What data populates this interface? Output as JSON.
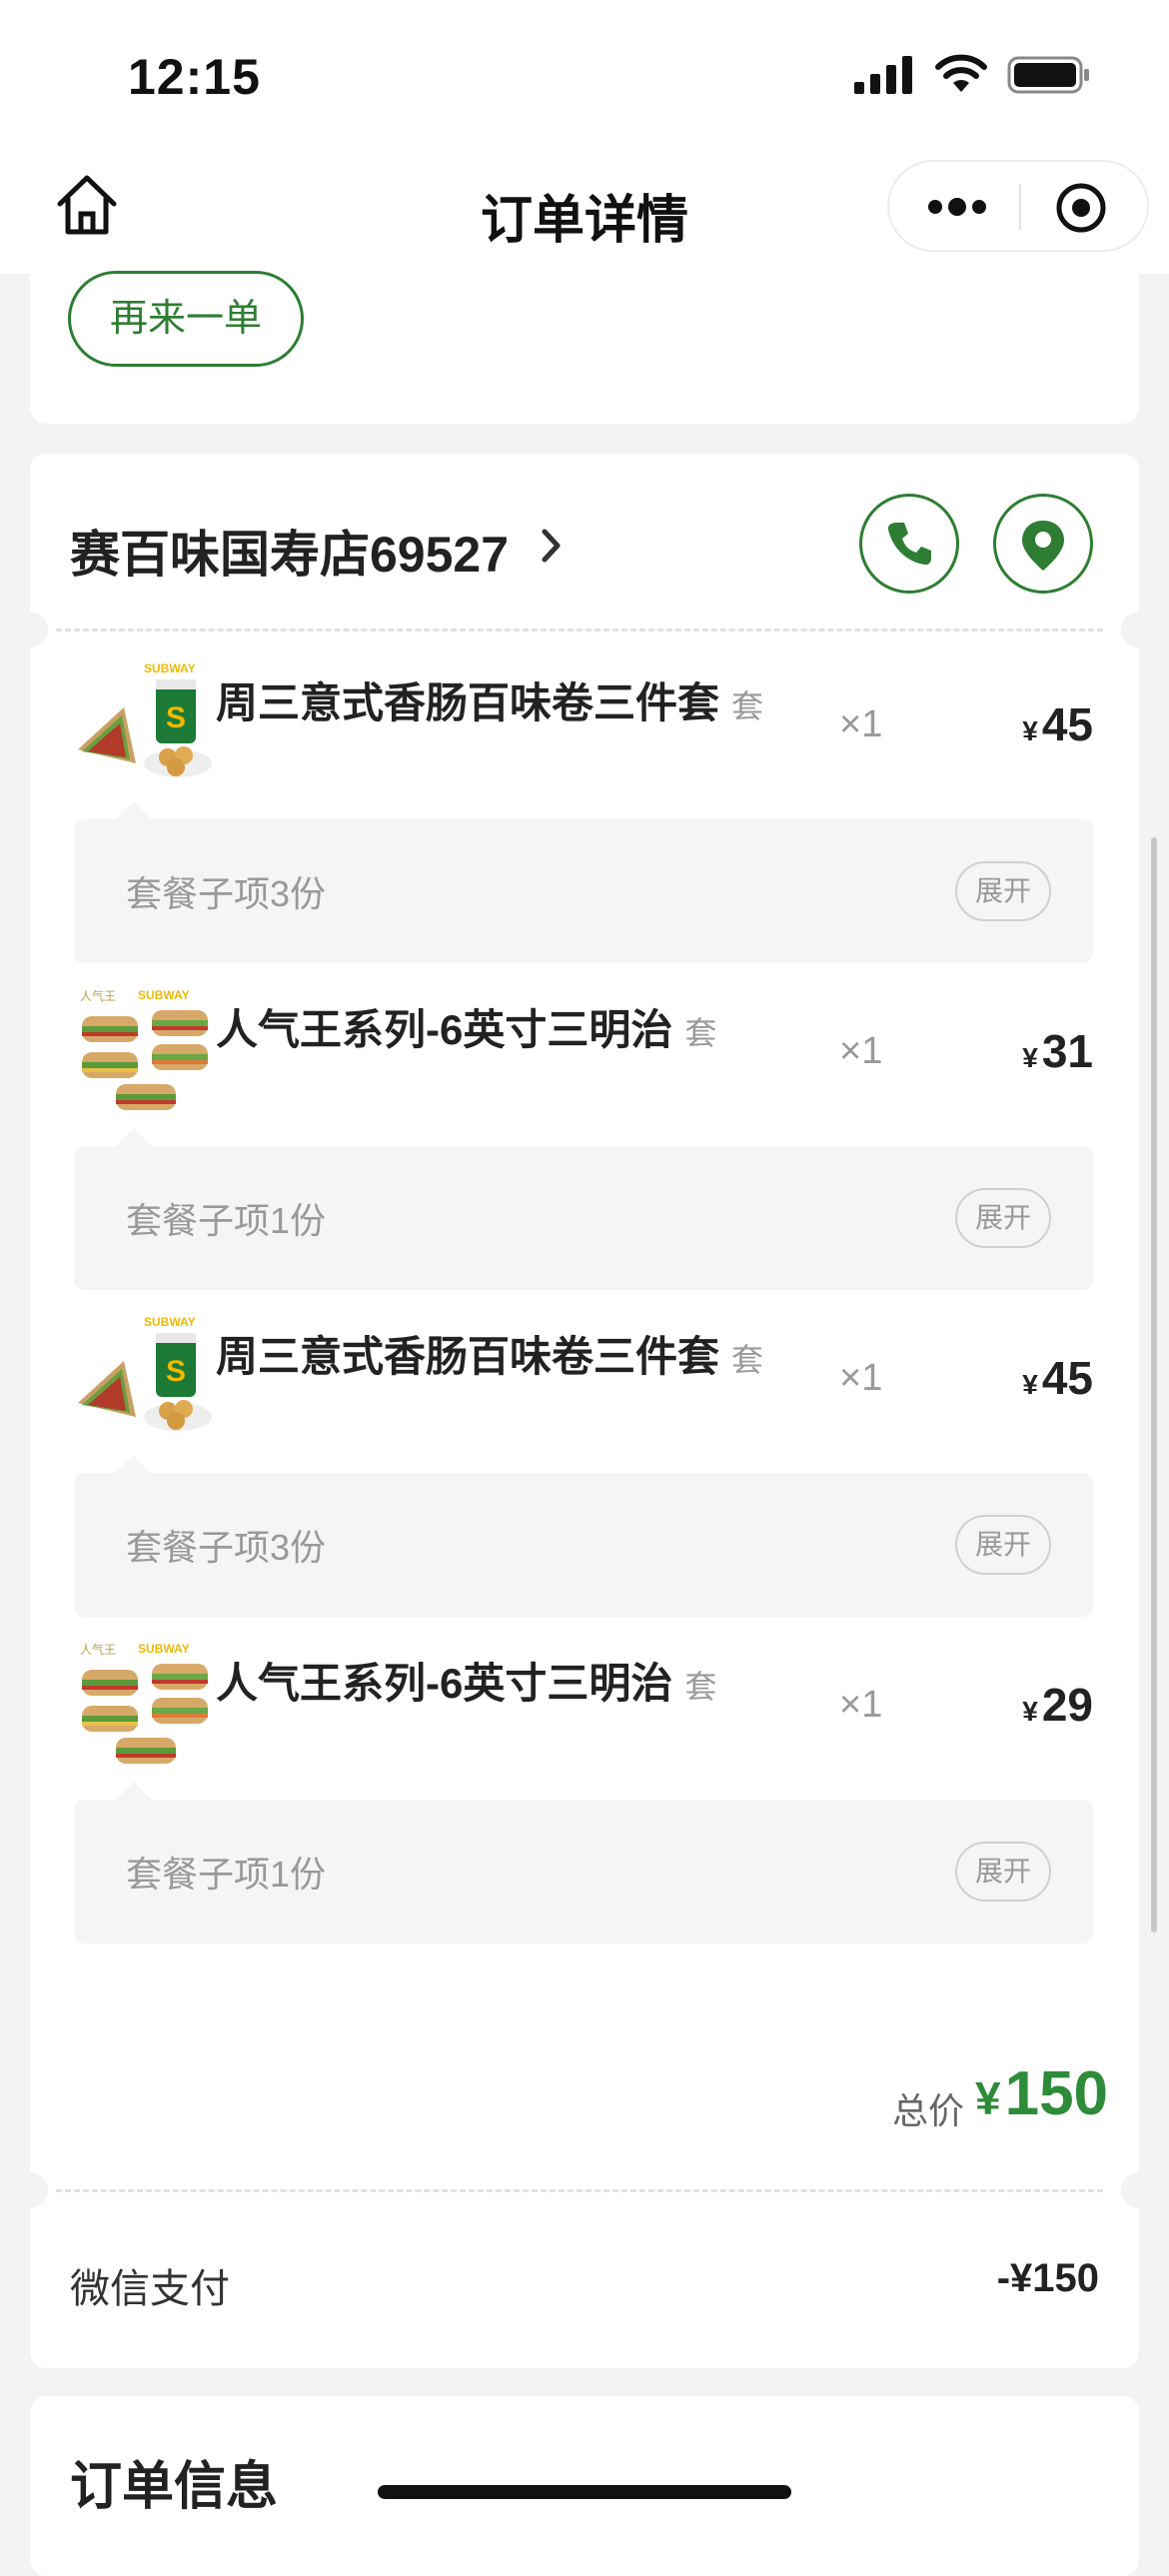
{
  "status": {
    "time": "12:15"
  },
  "nav": {
    "title": "订单详情"
  },
  "actions": {
    "reorder": "再来一单"
  },
  "store": {
    "name": "赛百味国寿店69527"
  },
  "items": [
    {
      "name": "周三意式香肠百味卷三件套",
      "tag": "套",
      "qty": "×1",
      "currency": "¥",
      "price": "45",
      "sub": "套餐子项3份",
      "expand": "展开"
    },
    {
      "name": "人气王系列-6英寸三明治",
      "tag": "套",
      "qty": "×1",
      "currency": "¥",
      "price": "31",
      "sub": "套餐子项1份",
      "expand": "展开"
    },
    {
      "name": "周三意式香肠百味卷三件套",
      "tag": "套",
      "qty": "×1",
      "currency": "¥",
      "price": "45",
      "sub": "套餐子项3份",
      "expand": "展开"
    },
    {
      "name": "人气王系列-6英寸三明治",
      "tag": "套",
      "qty": "×1",
      "currency": "¥",
      "price": "29",
      "sub": "套餐子项1份",
      "expand": "展开"
    }
  ],
  "total": {
    "label": "总价",
    "currency": "¥",
    "value": "150"
  },
  "payment": {
    "method": "微信支付",
    "amount": "-¥150"
  },
  "order_info": {
    "title": "订单信息"
  },
  "colors": {
    "accent": "#2e7d32",
    "price_green": "#2e8b3a"
  },
  "icons": [
    "home-icon",
    "more-icon",
    "close-circle-icon",
    "phone-icon",
    "location-icon",
    "chevron-right-icon"
  ]
}
